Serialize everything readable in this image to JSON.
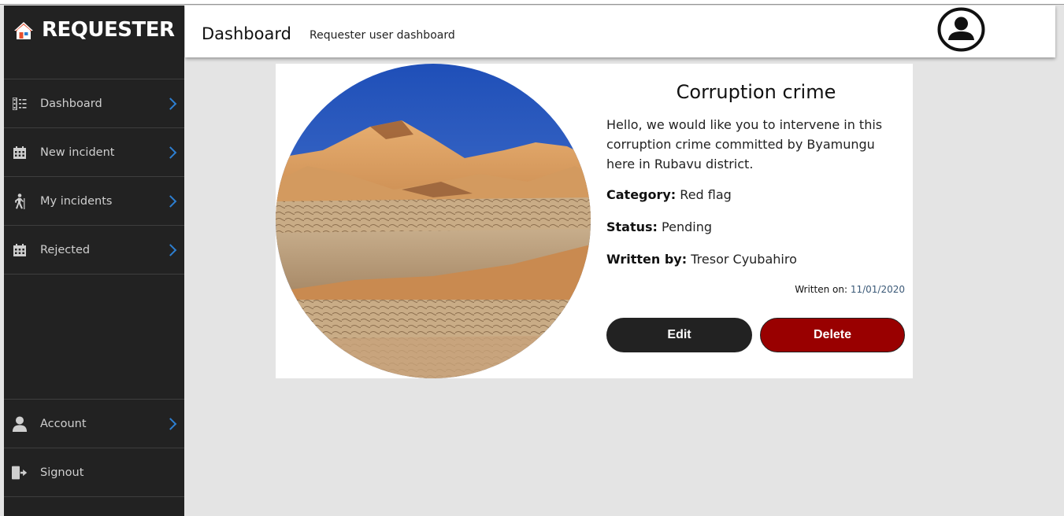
{
  "brand": {
    "title": "REQUESTER"
  },
  "sidebar": {
    "items": [
      {
        "label": "Dashboard",
        "icon": "dashboard-list-icon"
      },
      {
        "label": "New incident",
        "icon": "calendar-icon"
      },
      {
        "label": "My incidents",
        "icon": "walker-icon"
      },
      {
        "label": "Rejected",
        "icon": "calendar-icon"
      }
    ],
    "bottom": [
      {
        "label": "Account",
        "icon": "user-icon"
      },
      {
        "label": "Signout",
        "icon": "signout-icon"
      }
    ]
  },
  "header": {
    "title": "Dashboard",
    "subtitle": "Requester user dashboard"
  },
  "incident": {
    "title": "Corruption crime",
    "description": "Hello, we would like you to intervene in this corruption crime committed by Byamungu here in Rubavu district.",
    "category_label": "Category:",
    "category": "Red flag",
    "status_label": "Status:",
    "status": "Pending",
    "author_label": "Written by:",
    "author": "Tresor Cyubahiro",
    "written_on_label": "Written on:",
    "written_on": "11/01/2020",
    "edit_label": "Edit",
    "delete_label": "Delete"
  },
  "colors": {
    "sidebar_bg": "#222222",
    "accent_chevron": "#2d7fd1",
    "delete_button": "#990000",
    "edit_button": "#222222"
  }
}
